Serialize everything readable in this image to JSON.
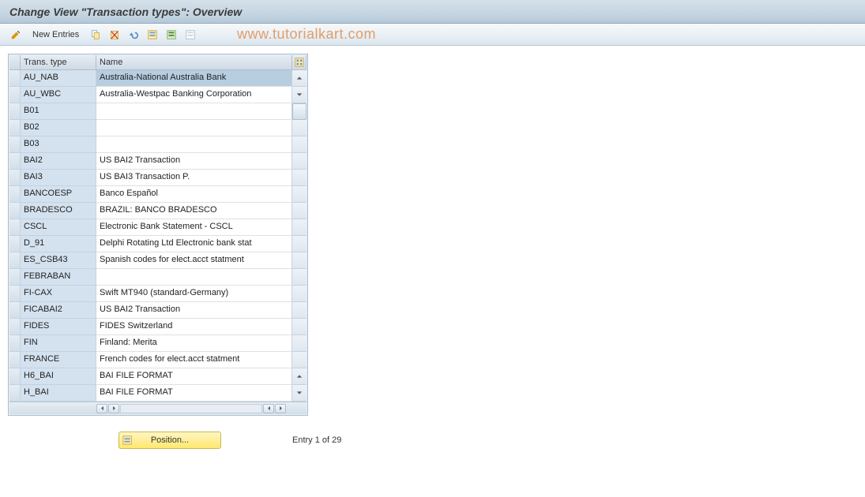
{
  "title": "Change View \"Transaction types\": Overview",
  "toolbar": {
    "new_entries_label": "New Entries"
  },
  "watermark": "www.tutorialkart.com",
  "table": {
    "columns": {
      "code": "Trans. type",
      "name": "Name"
    },
    "rows": [
      {
        "code": "AU_NAB",
        "name": "Australia-National Australia Bank",
        "selected": true
      },
      {
        "code": "AU_WBC",
        "name": "Australia-Westpac Banking Corporation"
      },
      {
        "code": "B01",
        "name": ""
      },
      {
        "code": "B02",
        "name": ""
      },
      {
        "code": "B03",
        "name": ""
      },
      {
        "code": "BAI2",
        "name": "US BAI2 Transaction"
      },
      {
        "code": "BAI3",
        "name": "US BAI3 Transaction P."
      },
      {
        "code": "BANCOESP",
        "name": "Banco Español"
      },
      {
        "code": "BRADESCO",
        "name": "BRAZIL: BANCO BRADESCO"
      },
      {
        "code": "CSCL",
        "name": "Electronic Bank Statement - CSCL"
      },
      {
        "code": "D_91",
        "name": "Delphi Rotating Ltd Electronic bank stat"
      },
      {
        "code": "ES_CSB43",
        "name": "Spanish codes for elect.acct statment"
      },
      {
        "code": "FEBRABAN",
        "name": ""
      },
      {
        "code": "FI-CAX",
        "name": "Swift MT940 (standard-Germany)"
      },
      {
        "code": "FICABAI2",
        "name": "US BAI2 Transaction"
      },
      {
        "code": "FIDES",
        "name": "FIDES Switzerland"
      },
      {
        "code": "FIN",
        "name": "Finland: Merita"
      },
      {
        "code": "FRANCE",
        "name": "French codes for elect.acct statment"
      },
      {
        "code": "H6_BAI",
        "name": "BAI FILE FORMAT"
      },
      {
        "code": "H_BAI",
        "name": "BAI FILE FORMAT"
      }
    ]
  },
  "footer": {
    "position_label": "Position...",
    "entry_info": "Entry 1 of 29"
  }
}
